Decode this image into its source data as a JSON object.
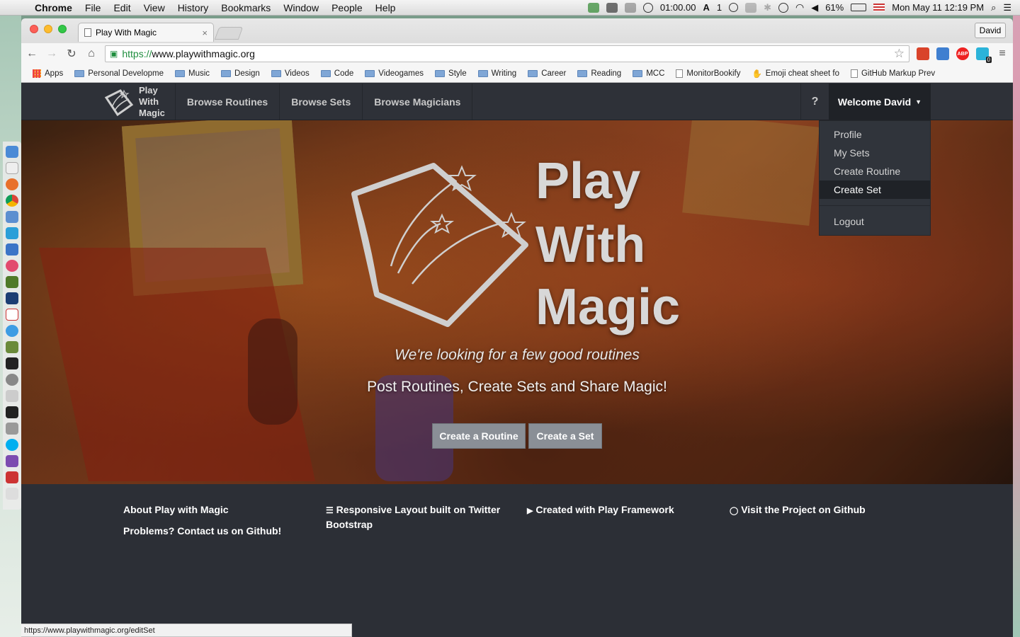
{
  "menubar": {
    "apple_glyph": "",
    "items": [
      "Chrome",
      "File",
      "Edit",
      "View",
      "History",
      "Bookmarks",
      "Window",
      "People",
      "Help"
    ],
    "timer": "01:00.00",
    "input_indicator": "1",
    "battery": "61%",
    "clock": "Mon May 11  12:19 PM"
  },
  "browser": {
    "tab_title": "Play With Magic",
    "tab_close": "×",
    "profile": "David",
    "url_scheme": "https://",
    "url_rest": "www.playwithmagic.org",
    "extension_badge": "0",
    "bookmarks": [
      "Apps",
      "Personal Developme",
      "Music",
      "Design",
      "Videos",
      "Code",
      "Videogames",
      "Style",
      "Writing",
      "Career",
      "Reading",
      "MCC",
      "MonitorBookify",
      "Emoji cheat sheet fo",
      "GitHub Markup Prev"
    ],
    "status_url": "https://www.playwithmagic.org/editSet"
  },
  "site": {
    "brand": [
      "Play",
      "With",
      "Magic"
    ],
    "nav": [
      "Browse Routines",
      "Browse Sets",
      "Browse Magicians"
    ],
    "help": "?",
    "welcome": "Welcome David",
    "dropdown": [
      "Profile",
      "My Sets",
      "Create Routine",
      "Create Set",
      "Logout"
    ],
    "hero": {
      "title": [
        "Play",
        "With",
        "Magic"
      ],
      "tagline": "We're looking for a few good routines",
      "subtitle": "Post Routines, Create Sets and Share Magic!",
      "buttons": [
        "Create a Routine",
        "Create a Set"
      ]
    },
    "footer": {
      "about": "About Play with Magic",
      "problems": "Problems? Contact us on Github!",
      "bootstrap": "Responsive Layout built on Twitter Bootstrap",
      "play": "Created with Play Framework",
      "github": "Visit the Project on Github"
    }
  },
  "colors": {
    "navbar": "#2e3138",
    "footer": "#2c2f36",
    "dropdown_active": "#1f2227",
    "hero_button": "#8a8f96"
  }
}
